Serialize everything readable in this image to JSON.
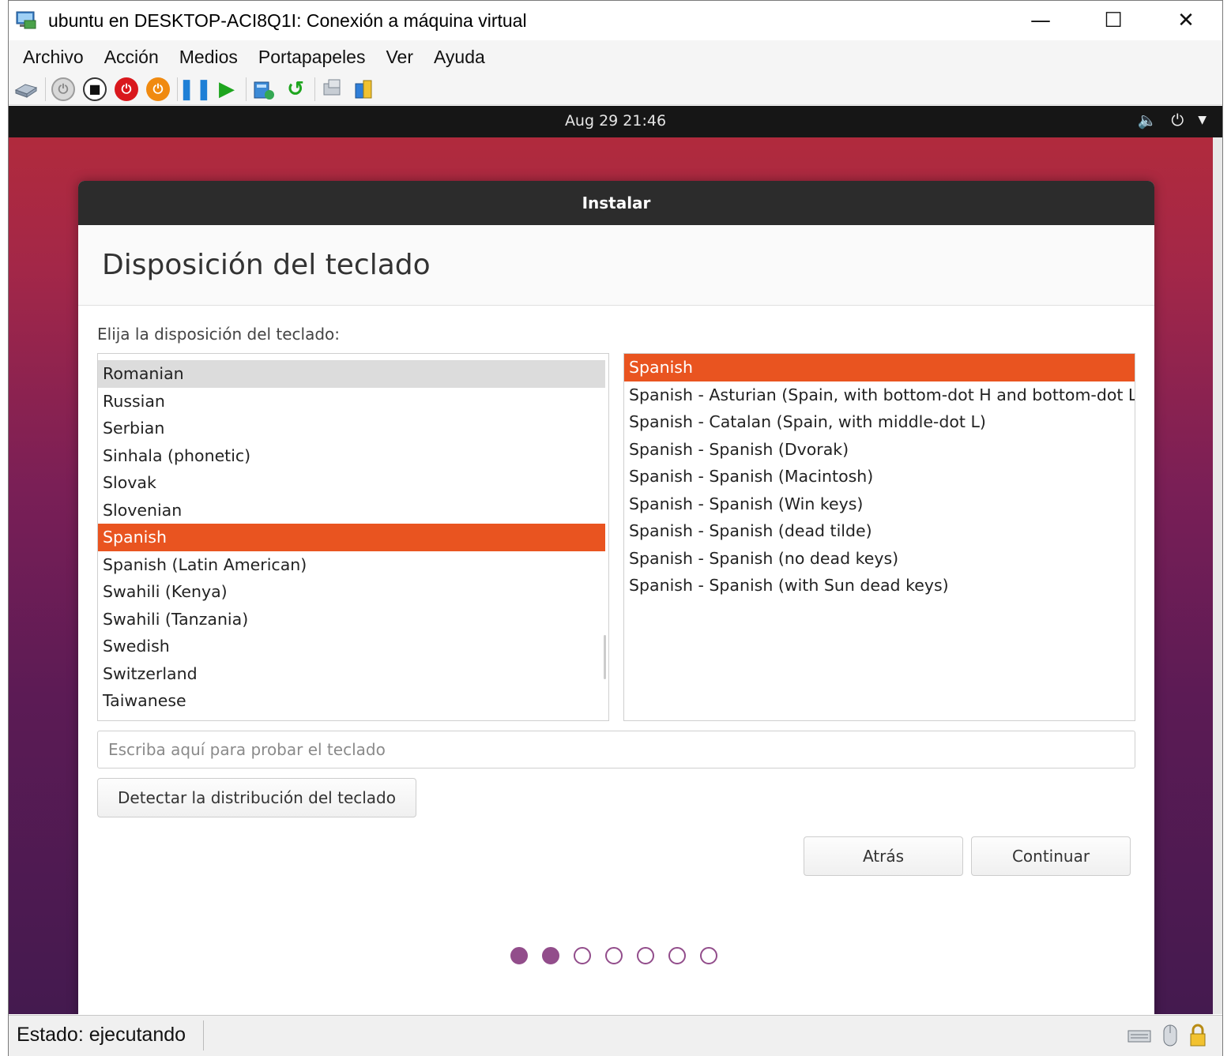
{
  "window": {
    "title": "ubuntu en DESKTOP-ACI8Q1I: Conexión a máquina virtual",
    "minimize": "—",
    "maximize": "☐",
    "close": "✕"
  },
  "menu": [
    "Archivo",
    "Acción",
    "Medios",
    "Portapapeles",
    "Ver",
    "Ayuda"
  ],
  "toolbar_icons": [
    "ctrl-alt-del-icon",
    "start-icon",
    "turn-off-icon",
    "shut-down-icon",
    "save-icon",
    "pause-icon",
    "resume-icon",
    "checkpoint-icon",
    "revert-icon",
    "enhanced-session-icon",
    "share-icon"
  ],
  "guest_topbar": {
    "clock": "Aug 29  21:46",
    "icons": [
      "volume-icon",
      "power-icon",
      "dropdown-arrow-icon"
    ]
  },
  "installer": {
    "header": "Instalar",
    "title": "Disposición del teclado",
    "prompt": "Elija la disposición del teclado:",
    "layouts": [
      {
        "label": "Romanian",
        "state": "hover"
      },
      {
        "label": "Russian",
        "state": ""
      },
      {
        "label": "Serbian",
        "state": ""
      },
      {
        "label": "Sinhala (phonetic)",
        "state": ""
      },
      {
        "label": "Slovak",
        "state": ""
      },
      {
        "label": "Slovenian",
        "state": ""
      },
      {
        "label": "Spanish",
        "state": "selected"
      },
      {
        "label": "Spanish (Latin American)",
        "state": ""
      },
      {
        "label": "Swahili (Kenya)",
        "state": ""
      },
      {
        "label": "Swahili (Tanzania)",
        "state": ""
      },
      {
        "label": "Swedish",
        "state": ""
      },
      {
        "label": "Switzerland",
        "state": ""
      },
      {
        "label": "Taiwanese",
        "state": ""
      }
    ],
    "variants": [
      {
        "label": "Spanish",
        "state": "selected"
      },
      {
        "label": "Spanish - Asturian (Spain, with bottom-dot H and bottom-dot L)",
        "state": ""
      },
      {
        "label": "Spanish - Catalan (Spain, with middle-dot L)",
        "state": ""
      },
      {
        "label": "Spanish - Spanish (Dvorak)",
        "state": ""
      },
      {
        "label": "Spanish - Spanish (Macintosh)",
        "state": ""
      },
      {
        "label": "Spanish - Spanish (Win keys)",
        "state": ""
      },
      {
        "label": "Spanish - Spanish (dead tilde)",
        "state": ""
      },
      {
        "label": "Spanish - Spanish (no dead keys)",
        "state": ""
      },
      {
        "label": "Spanish - Spanish (with Sun dead keys)",
        "state": ""
      }
    ],
    "test_placeholder": "Escriba aquí para probar el teclado",
    "detect_button": "Detectar la distribución del teclado",
    "back_button": "Atrás",
    "continue_button": "Continuar",
    "progress": {
      "total_steps": 7,
      "completed_steps": 2
    }
  },
  "statusbar": {
    "status": "Estado: ejecutando",
    "icons": [
      "keyboard-icon",
      "mouse-icon",
      "lock-icon"
    ]
  },
  "colors": {
    "accent": "#e95420",
    "progress_dot": "#924d8b",
    "dialog_header": "#2c2c2c"
  }
}
